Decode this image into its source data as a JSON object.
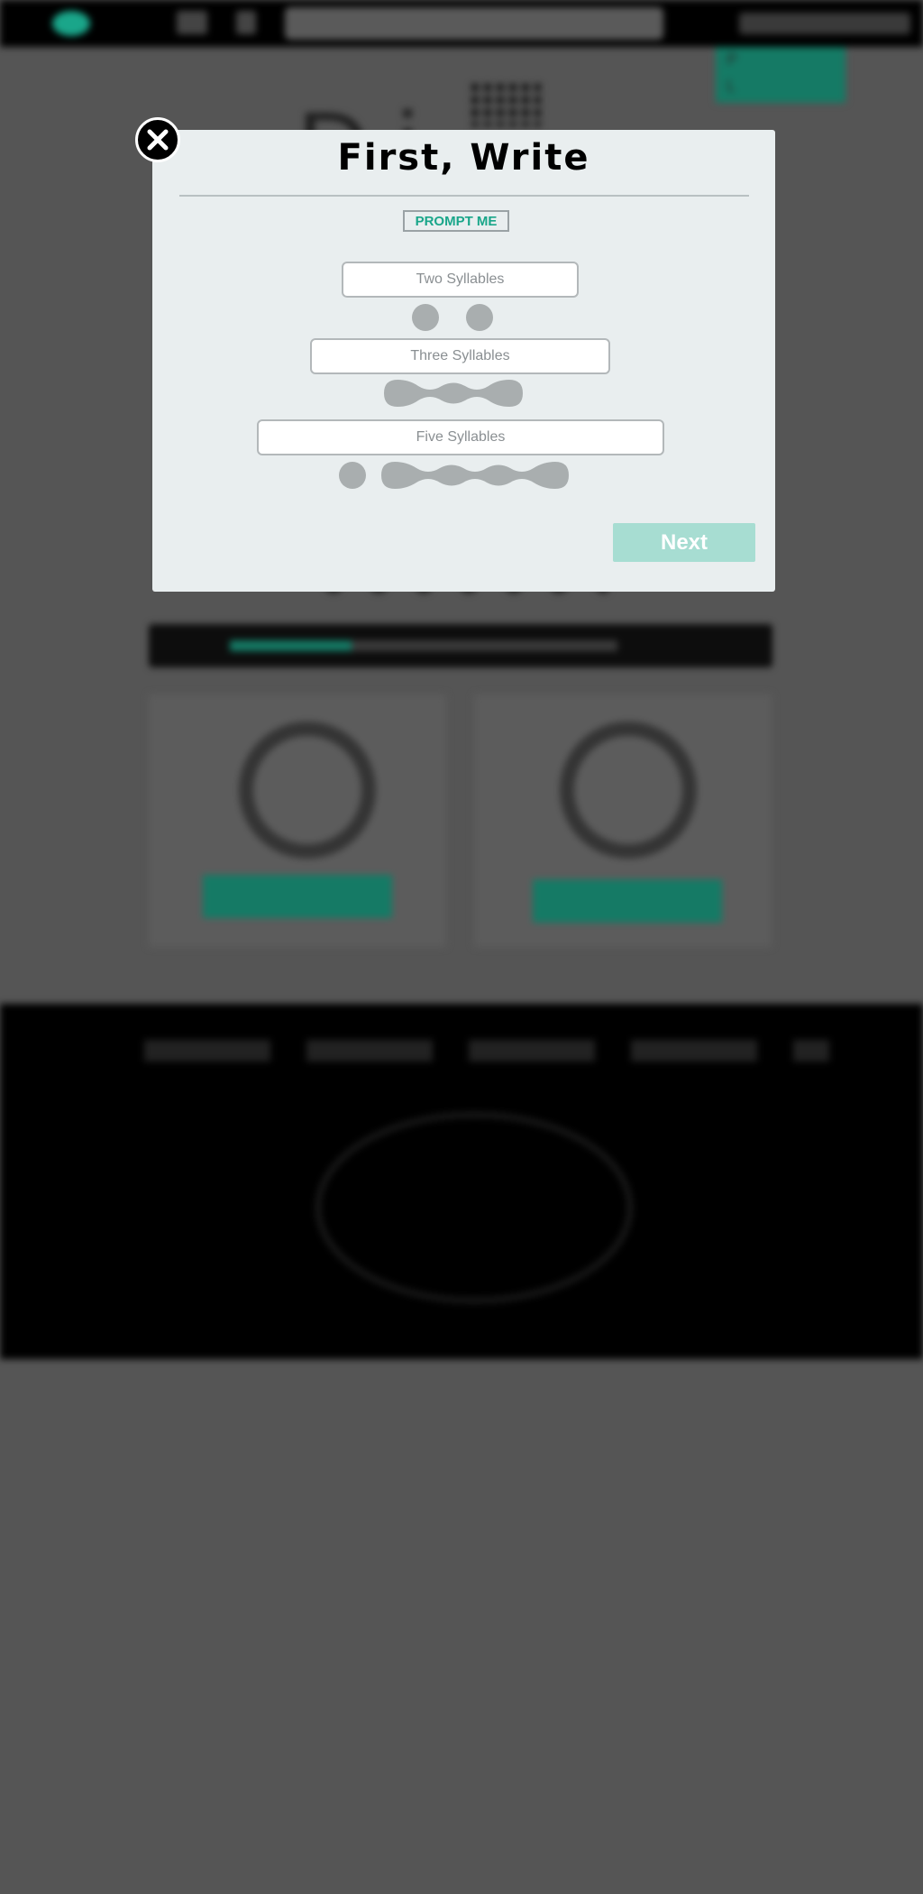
{
  "modal": {
    "title": "First, Write",
    "prompt_label": "PROMPT ME",
    "lines": [
      {
        "placeholder": "Two Syllables",
        "value": "",
        "syllables": 2
      },
      {
        "placeholder": "Three Syllables",
        "value": "",
        "syllables": 3
      },
      {
        "placeholder": "Five Syllables",
        "value": "",
        "syllables": 5
      }
    ],
    "next_label": "Next"
  },
  "background_page": {
    "dropdown_items": [
      "P",
      "L"
    ]
  },
  "colors": {
    "accent": "#1aa68a",
    "accent_disabled": "#a7ddd2",
    "modal_bg": "#e9eeef",
    "syllable_marker": "#a9aeaf",
    "backdrop": "#555555"
  }
}
